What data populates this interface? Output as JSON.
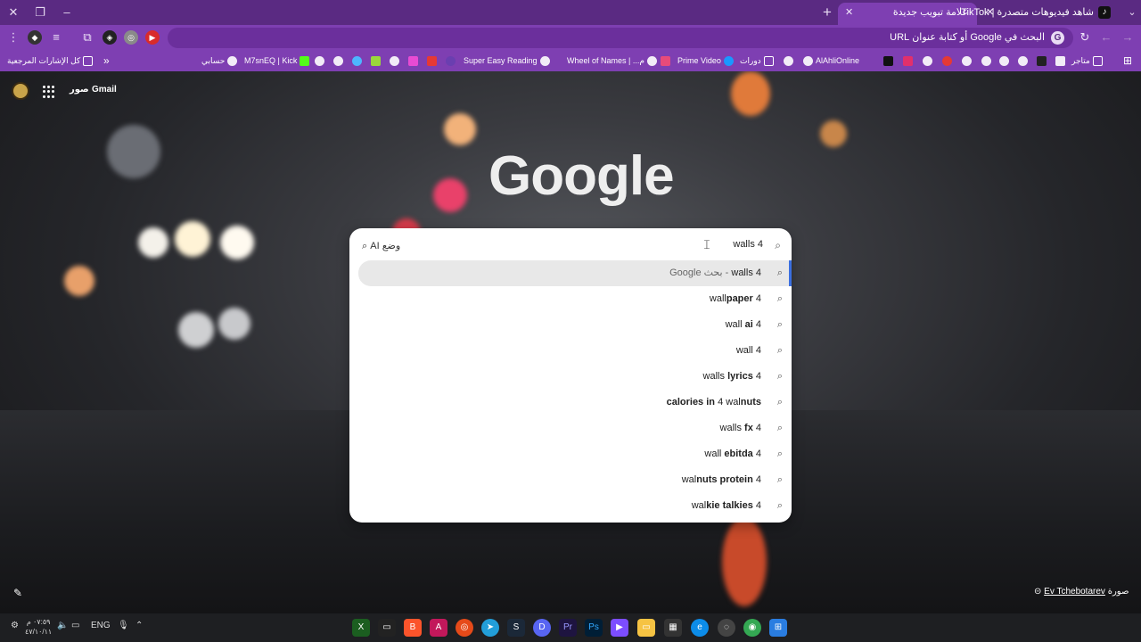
{
  "tabs": [
    {
      "title": "شاهد فيديوهات متصدرة | TikTok",
      "active": false
    },
    {
      "title": "علامة تبويب جديدة",
      "active": true
    }
  ],
  "omnibox": {
    "placeholder": "البحث في Google أو كتابة عنوان URL"
  },
  "bookmarks": {
    "all_bookmarks": "كل الإشارات المرجعية",
    "account": "حسابي",
    "kick": "M7snEQ | Kick",
    "super_easy": "Super Easy Reading",
    "wheel": "Wheel of Names | ...م",
    "prime": "Prime Video",
    "courses": "دورات",
    "alahli": "AlAhliOnline",
    "stores": "متاجر"
  },
  "page": {
    "gmail": "Gmail",
    "images": "صور",
    "logo": "Google",
    "photo_credit_prefix": "صورة",
    "photo_credit_author": "Ev Tchebotarev"
  },
  "search": {
    "query": "walls 4",
    "ai_mode": "وضع AI",
    "suggestions": [
      {
        "plain": "walls 4",
        "suffix": " - بحث Google"
      },
      {
        "plain": "wall",
        "bold": "paper",
        "tail": " 4"
      },
      {
        "plain": "wall ",
        "bold": "ai",
        "tail": " 4"
      },
      {
        "plain": "wall",
        "bold": "",
        "tail": " 4"
      },
      {
        "plain": "walls ",
        "bold": "lyrics",
        "tail": " 4"
      },
      {
        "pre": "calories in",
        "plain": " 4 wal",
        "bold": "nuts",
        "tail": ""
      },
      {
        "plain": "walls ",
        "bold": "fx",
        "tail": " 4"
      },
      {
        "plain": "wall ",
        "bold": "ebitda",
        "tail": " 4"
      },
      {
        "plain": "wal",
        "bold": "nuts protein",
        "tail": " 4"
      },
      {
        "plain": "wal",
        "bold": "kie talkies",
        "tail": " 4"
      }
    ]
  },
  "taskbar": {
    "lang": "ENG",
    "time": "٠٧:٥٩ م",
    "date": "٤٧/١٠/١١"
  },
  "colors": {
    "tab_strip": "#5a2a82",
    "toolbar": "#7e3fb2",
    "accent": "#3b6fe0"
  }
}
